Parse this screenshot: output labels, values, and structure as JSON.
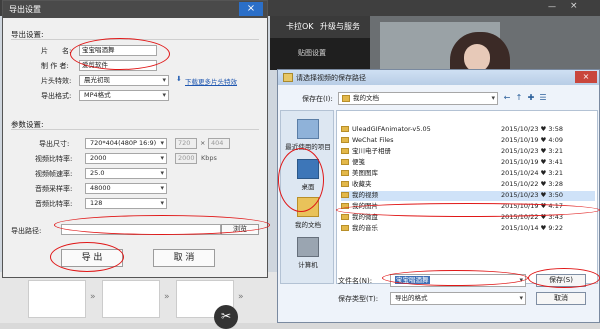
{
  "background": {
    "tabs": [
      "卡拉OK",
      "升级与服务"
    ],
    "strip_label": "贴图设置",
    "scissors_icon": "scissors-icon"
  },
  "export_dialog": {
    "title": "导出设置",
    "close_label": "×",
    "basic_section": "导出设置:",
    "name_label": "片　　名:",
    "name_value": "宝宝唱酒舞",
    "author_label": "制 作 者:",
    "author_value": "爱剪软件",
    "effect_label": "片头特效:",
    "effect_value": "晨光初现",
    "plugin_link": "下载更多片头特效",
    "format_label": "导出格式:",
    "format_value": "MP4格式",
    "param_section": "参数设置:",
    "size_label": "导出尺寸:",
    "size_value": "720*404(480P 16:9)",
    "width_value": "720",
    "size_x": "×",
    "height_value": "404",
    "vbitrate_label": "视频比特率:",
    "vbitrate_value": "2000",
    "vbitrate_custom": "2000",
    "vbitrate_unit": "Kbps",
    "framerate_label": "视频帧速率:",
    "framerate_value": "25.0",
    "samplerate_label": "音频采样率:",
    "samplerate_value": "48000",
    "abitrate_label": "音频比特率:",
    "abitrate_value": "128",
    "path_label": "导出路径:",
    "path_value": "",
    "browse_label": "浏览",
    "export_label": "导 出",
    "cancel_label": "取 消"
  },
  "save_dialog": {
    "title": "请选择视频的保存路径",
    "close_label": "×",
    "save_in_label": "保存在(I):",
    "save_in_value": "我的文档",
    "places": [
      {
        "label": "最近使用的项目",
        "icon": "recent-items-icon"
      },
      {
        "label": "桌面",
        "icon": "desktop-icon"
      },
      {
        "label": "我的文档",
        "icon": "my-documents-icon"
      },
      {
        "label": "计算机",
        "icon": "computer-icon"
      }
    ],
    "files": [
      {
        "name": "UleadGIFAnimator-v5.05",
        "date": "2015/10/23 ♥ 3:58"
      },
      {
        "name": "WeChat Files",
        "date": "2015/10/19 ♥ 4:09"
      },
      {
        "name": "宝川电子相册",
        "date": "2015/10/23 ♥ 3:21"
      },
      {
        "name": "便笺",
        "date": "2015/10/19 ♥ 3:41"
      },
      {
        "name": "美图图库",
        "date": "2015/10/24 ♥ 3:21"
      },
      {
        "name": "收藏夹",
        "date": "2015/10/22 ♥ 3:28"
      },
      {
        "name": "我的视频",
        "date": "2015/10/23 ♥ 3:50"
      },
      {
        "name": "我的图片",
        "date": "2015/10/19 ♥ 4:17"
      },
      {
        "name": "我的微盘",
        "date": "2015/10/22 ♥ 3:43"
      },
      {
        "name": "我的音乐",
        "date": "2015/10/14 ♥ 9:22"
      }
    ],
    "filename_label": "文件名(N):",
    "filename_value": "宝宝唱酒舞",
    "filetype_label": "保存类型(T):",
    "filetype_value": "导出的格式",
    "save_label": "保存(S)",
    "cancel_label": "取消"
  },
  "colors": {
    "annotation_red": "#e01818",
    "dialog_blue": "#2b6fc8"
  }
}
